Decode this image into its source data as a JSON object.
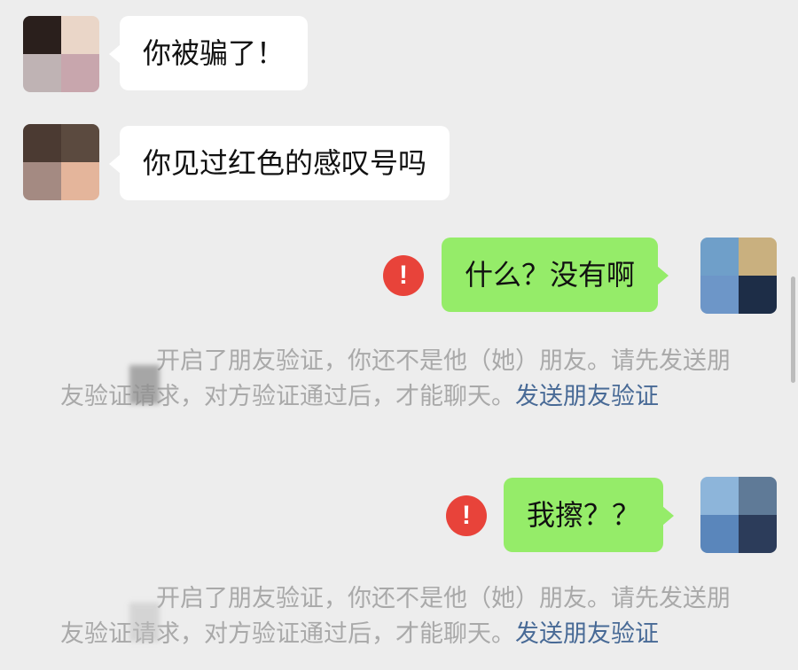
{
  "messages": [
    {
      "side": "in",
      "text": "你被骗了！",
      "avatar": [
        "#2a1f1c",
        "#ead6c8",
        "#bfb3b4",
        "#c8a6ad"
      ]
    },
    {
      "side": "in",
      "text": "你见过红色的感叹号吗",
      "avatar": [
        "#4b3a32",
        "#5b4a3f",
        "#a48a82",
        "#e4b59b"
      ]
    },
    {
      "side": "out",
      "text": "什么？没有啊",
      "status": "!",
      "avatar": [
        "#6f9fc9",
        "#c9b07f",
        "#6d96c8",
        "#1d2d47"
      ]
    },
    {
      "side": "out",
      "text": "我擦？？",
      "status": "!",
      "avatar": [
        "#8db5da",
        "#5f7a97",
        "#5a86bb",
        "#2c3c5a"
      ]
    }
  ],
  "system_notice": {
    "text": "开启了朋友验证，你还不是他（她）朋友。请先发送朋友验证请求，对方验证通过后，才能聊天。",
    "link": "发送朋友验证"
  },
  "colors": {
    "background": "#ededed",
    "bubble_in": "#ffffff",
    "bubble_out": "#95ec69",
    "error": "#e8433a",
    "notice_text": "#a9a9a9",
    "link": "#486a96"
  }
}
